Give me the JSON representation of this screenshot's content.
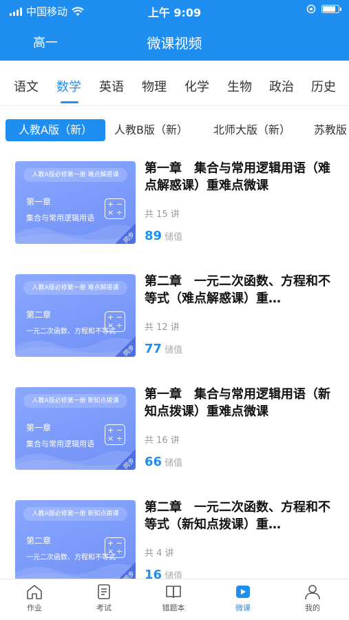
{
  "status_bar": {
    "carrier": "中国移动",
    "time": "上午 9:09"
  },
  "header": {
    "grade": "高一",
    "title": "微课视频"
  },
  "subjects": [
    "语文",
    "数学",
    "英语",
    "物理",
    "化学",
    "生物",
    "政治",
    "历史"
  ],
  "active_subject": "数学",
  "editions": [
    "人教A版（新）",
    "人教B版（新）",
    "北师大版（新）",
    "苏教版"
  ],
  "courses": [
    {
      "thumb_header": "人教A版必修第一册   难点解惑课",
      "thumb_chapter": "第一章",
      "thumb_subtitle": "集合与常用逻辑用语",
      "title": "第一章　集合与常用逻辑用语（难点解惑课）重难点微课",
      "lessons": "共 15 讲",
      "price": "89",
      "price_unit": "储值"
    },
    {
      "thumb_header": "人教A版必修第一册   难点解惑课",
      "thumb_chapter": "第二章",
      "thumb_subtitle": "一元二次函数、方程和不等式",
      "title": "第二章　一元二次函数、方程和不等式（难点解惑课）重…",
      "lessons": "共 12 讲",
      "price": "77",
      "price_unit": "储值"
    },
    {
      "thumb_header": "人教A版必修第一册   新知点拨课",
      "thumb_chapter": "第一章",
      "thumb_subtitle": "集合与常用逻辑用语",
      "title": "第一章　集合与常用逻辑用语（新知点拨课）重难点微课",
      "lessons": "共 16 讲",
      "price": "66",
      "price_unit": "储值"
    },
    {
      "thumb_header": "人教A版必修第一册   新知点拨课",
      "thumb_chapter": "第二章",
      "thumb_subtitle": "一元二次函数、方程和不等式",
      "title": "第二章　一元二次函数、方程和不等式（新知点拨课）重…",
      "lessons": "共 4 讲",
      "price": "16",
      "price_unit": "储值"
    }
  ],
  "thumb_tag": "同步",
  "thumb_calc": "+ −\n× ÷",
  "tabbar": [
    {
      "label": "作业",
      "icon": "home-icon"
    },
    {
      "label": "考试",
      "icon": "exam-icon"
    },
    {
      "label": "错题本",
      "icon": "book-icon"
    },
    {
      "label": "微课",
      "icon": "video-icon"
    },
    {
      "label": "我的",
      "icon": "user-icon"
    }
  ],
  "active_tab": "微课",
  "colors": {
    "accent": "#1f8ef1",
    "thumb": "#7b98f7"
  }
}
